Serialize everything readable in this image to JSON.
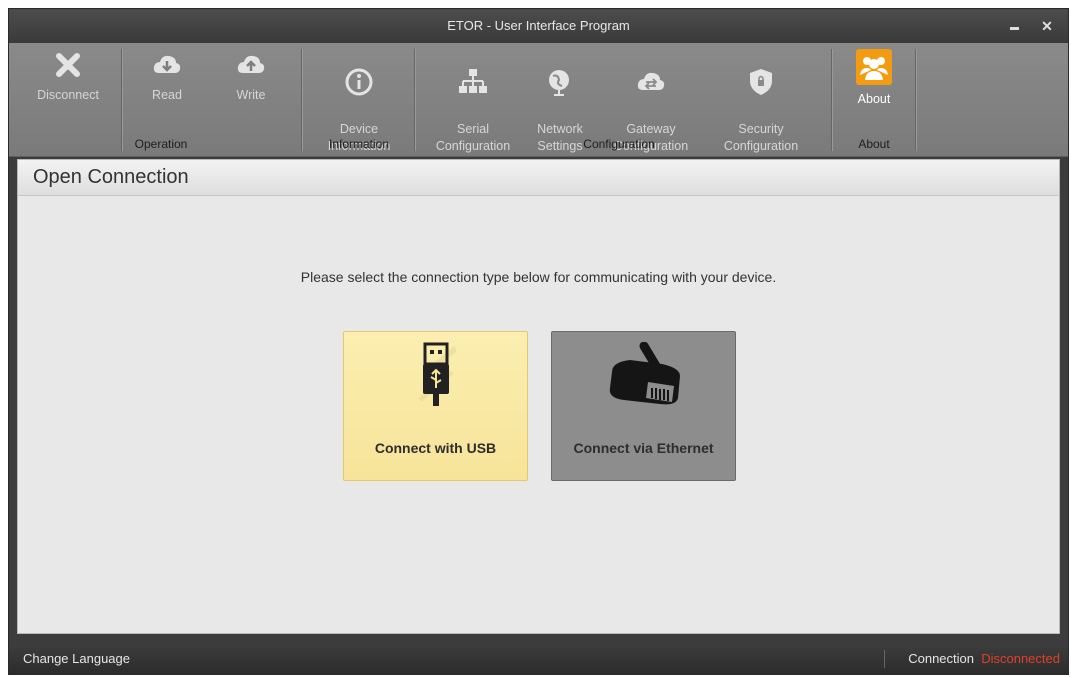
{
  "window": {
    "title": "ETOR - User Interface Program",
    "minimize_glyph": "",
    "close_glyph": "✕"
  },
  "ribbon": {
    "buttons": [
      {
        "label": "Disconnect",
        "icon": "x-icon"
      },
      {
        "label": "Read",
        "icon": "cloud-download-icon"
      },
      {
        "label": "Write",
        "icon": "cloud-upload-icon"
      },
      {
        "label": "Device\nInformation",
        "icon": "info-icon"
      },
      {
        "label": "Serial\nConfiguration",
        "icon": "network-tree-icon"
      },
      {
        "label": "Network\nSettings",
        "icon": "globe-icon"
      },
      {
        "label": "Gateway\nConfiguration",
        "icon": "gateway-icon"
      },
      {
        "label": "Security\nConfiguration",
        "icon": "shield-icon"
      },
      {
        "label": "About",
        "icon": "users-icon"
      }
    ],
    "groups": [
      "Operation",
      "Information",
      "Configuration",
      "About"
    ]
  },
  "panel": {
    "title": "Open Connection",
    "prompt": "Please select the connection type below for communicating with your device."
  },
  "connections": {
    "usb_label": "Connect with USB",
    "ethernet_label": "Connect via Ethernet"
  },
  "status": {
    "change_language": "Change Language",
    "connection_label": "Connection",
    "connection_value": "Disconnected",
    "connection_value_color": "#e0402a"
  },
  "colors": {
    "accent_about": "#f39c12",
    "usb_highlight": "#f7e49a"
  }
}
